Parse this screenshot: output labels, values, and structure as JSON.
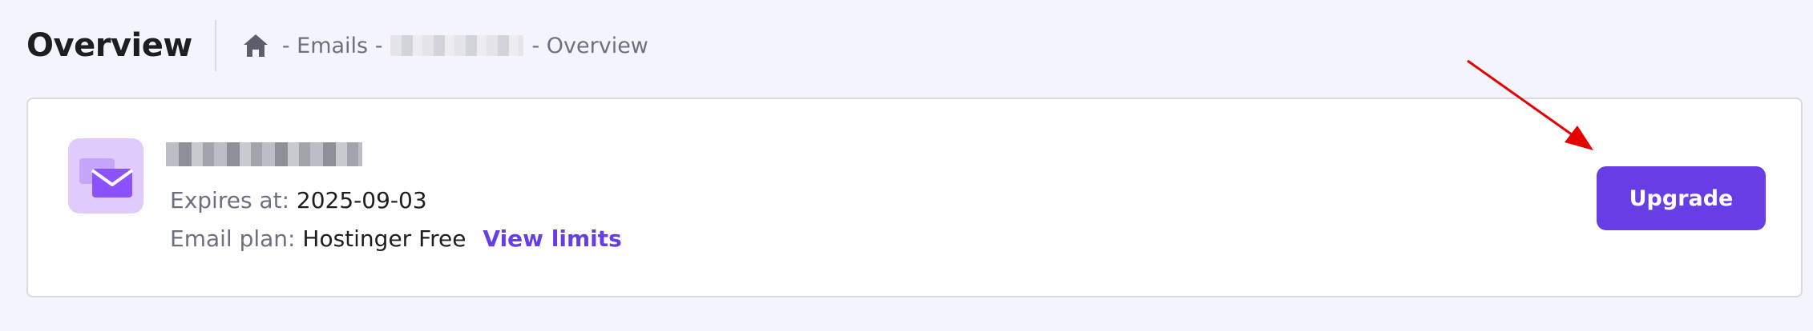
{
  "header": {
    "title": "Overview",
    "breadcrumb": {
      "home_icon": "home-icon",
      "sep1": "- Emails -",
      "domain_redacted": "",
      "sep2": "- Overview"
    }
  },
  "card": {
    "icon": "mail-icon",
    "expires_label": "Expires at:",
    "expires_value": "2025-09-03",
    "plan_label": "Email plan:",
    "plan_value": "Hostinger Free",
    "view_limits_label": "View limits",
    "upgrade_label": "Upgrade"
  },
  "colors": {
    "accent": "#673de6",
    "background": "#f4f4fd",
    "annotation_arrow": "#e60000"
  }
}
